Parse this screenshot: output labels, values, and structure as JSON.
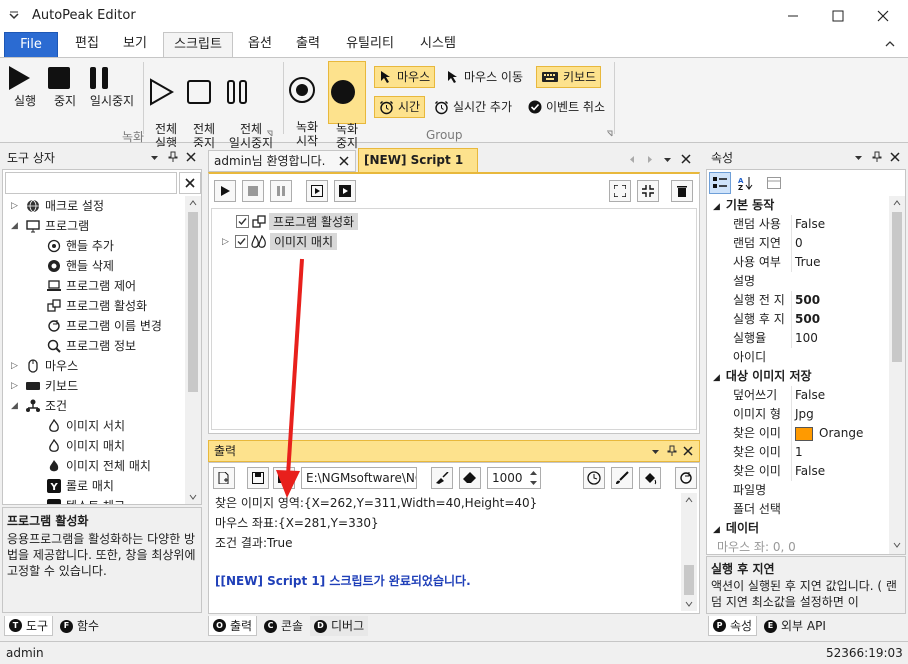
{
  "window": {
    "title": "AutoPeak Editor"
  },
  "ribbon_tabs": [
    "File",
    "편집",
    "보기",
    "스크립트",
    "옵션",
    "출력",
    "유틸리티",
    "시스템"
  ],
  "ribbon": {
    "run": "실행",
    "stop": "중지",
    "pause": "일시중지",
    "run_all": "전체\n실행",
    "stop_all": "전체\n중지",
    "pause_all": "전체\n일시중지",
    "group_record": "녹화",
    "rec_start": "녹화\n시작",
    "rec_stop": "녹화\n중지",
    "mouse": "마우스",
    "mouse_move": "마우스 이동",
    "keyboard": "키보드",
    "time": "시간",
    "realtime_add": "실시간 추가",
    "event_cancel": "이벤트 취소",
    "group_group": "Group"
  },
  "toolbox": {
    "title": "도구 상자",
    "items": [
      "매크로 설정",
      "프로그램",
      "핸들 추가",
      "핸들 삭제",
      "프로그램 제어",
      "프로그램 활성화",
      "프로그램 이름 변경",
      "프로그램 정보",
      "마우스",
      "키보드",
      "조건",
      "이미지 서치",
      "이미지 매치",
      "이미지 전체 매치",
      "롤로 매치",
      "텍스트 체크"
    ],
    "desc_title": "프로그램 활성화",
    "desc_text": "응용프로그램을 활성화하는 다양한 방법을 제공합니다. 또한, 창을 최상위에 고정할 수 있습니다.",
    "tab_tools": "도구",
    "tab_functions": "함수"
  },
  "doc_tabs": [
    "admin님 환영합니다.",
    "[NEW] Script 1"
  ],
  "script": {
    "lines": [
      "프로그램 활성화",
      "이미지 매치"
    ]
  },
  "output": {
    "title": "출력",
    "path": "E:\\NGMsoftware\\NG",
    "interval": "1000",
    "lines": [
      "찾은 이미지 영역:{X=262,Y=311,Width=40,Height=40}",
      "마우스 좌표:{X=281,Y=330}",
      "조건 결과:True",
      "",
      "[[NEW] Script 1] 스크립트가 완료되었습니다."
    ],
    "tab_output": "출력",
    "tab_console": "콘솔",
    "tab_debug": "디버그"
  },
  "properties": {
    "title": "속성",
    "cat1": "기본 동작",
    "rows1": [
      [
        "랜덤 사용",
        "False"
      ],
      [
        "랜덤 지연",
        "0"
      ],
      [
        "사용 여부",
        "True"
      ],
      [
        "설명",
        ""
      ],
      [
        "실행 전 지",
        "500"
      ],
      [
        "실행 후 지",
        "500"
      ],
      [
        "실행율",
        "100"
      ],
      [
        "아이디",
        ""
      ]
    ],
    "cat2": "대상 이미지 저장",
    "rows2": [
      [
        "덮어쓰기",
        "False"
      ],
      [
        "이미지 형",
        "Jpg"
      ],
      [
        "찾은 이미",
        "Orange"
      ],
      [
        "찾은 이미",
        "1"
      ],
      [
        "찾은 이미",
        "False"
      ],
      [
        "파일명",
        ""
      ],
      [
        "폴더 선택",
        ""
      ]
    ],
    "cat3": "데이터",
    "cut_row": "마우스 좌: 0, 0",
    "desc_title": "실행 후 지연",
    "desc_text": "액션이 실행된 후 지연 값입니다. ( 랜덤 지연 최소값을 설정하면 이",
    "tab_props": "속성",
    "tab_api": "외부 API",
    "color_accent": "#ff9a00"
  },
  "status": {
    "user": "admin",
    "time": "52366:19:03"
  }
}
